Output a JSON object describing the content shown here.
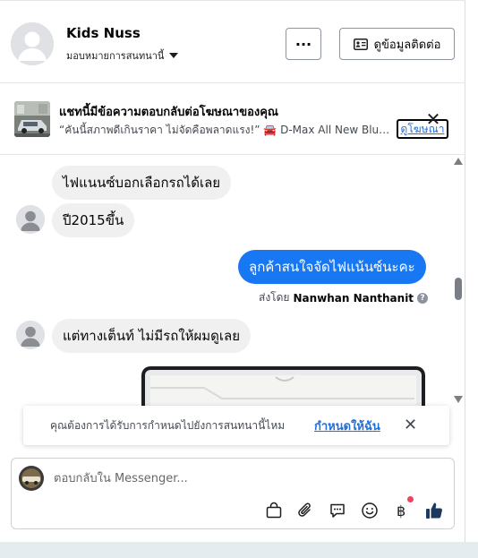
{
  "header": {
    "contact_name": "Kids Nuss",
    "assign_label": "มอบหมายการสนทนานี้",
    "more_label": "···",
    "info_button_label": "ดูข้อมูลติดต่อ"
  },
  "ad_banner": {
    "title": "แชทนี้มีข้อความตอบกลับต่อโฆษณาของคุณ",
    "subtitle": "“คันนี้สภาพดีเกินราคา ไม่จัดคือพลาดแรง!” 🚘 D-Max All New Blue Po...",
    "link_label": "ดูโฆษณา",
    "close_label": "✕"
  },
  "messages": [
    {
      "direction": "in",
      "text": "ไฟแนนซ์บอกเลือกรถได้เลย"
    },
    {
      "direction": "in",
      "text": "ปี2015ขึ้น"
    },
    {
      "direction": "out",
      "text": "ลูกค้าสนใจจัดไฟแน้นซ์นะคะ"
    },
    {
      "direction": "in",
      "text": "แต่ทางเต็นท์ ไม่มีรถให้ผมดูเลย"
    }
  ],
  "sent_by": {
    "prefix": "ส่งโดย",
    "name": "Nanwhan Nanthanit",
    "help_icon": "?"
  },
  "reminder": {
    "text": "คุณต้องการได้รับการกำหนดไปยังการสนทนานี้ไหม",
    "link_label": "กำหนดให้ฉัน",
    "close_label": "✕"
  },
  "composer": {
    "placeholder": "ตอบกลับใน Messenger..."
  },
  "colors": {
    "accent": "#1877f2",
    "link": "#216fdb",
    "incoming_bubble": "#f0f0f0",
    "notification_dot": "#f3425f"
  },
  "icons": [
    "person-icon",
    "contact-card-icon",
    "shopping-bag-icon",
    "paperclip-icon",
    "saved-replies-icon",
    "emoji-icon",
    "baht-payment-icon",
    "thumbs-up-icon",
    "close-icon"
  ]
}
